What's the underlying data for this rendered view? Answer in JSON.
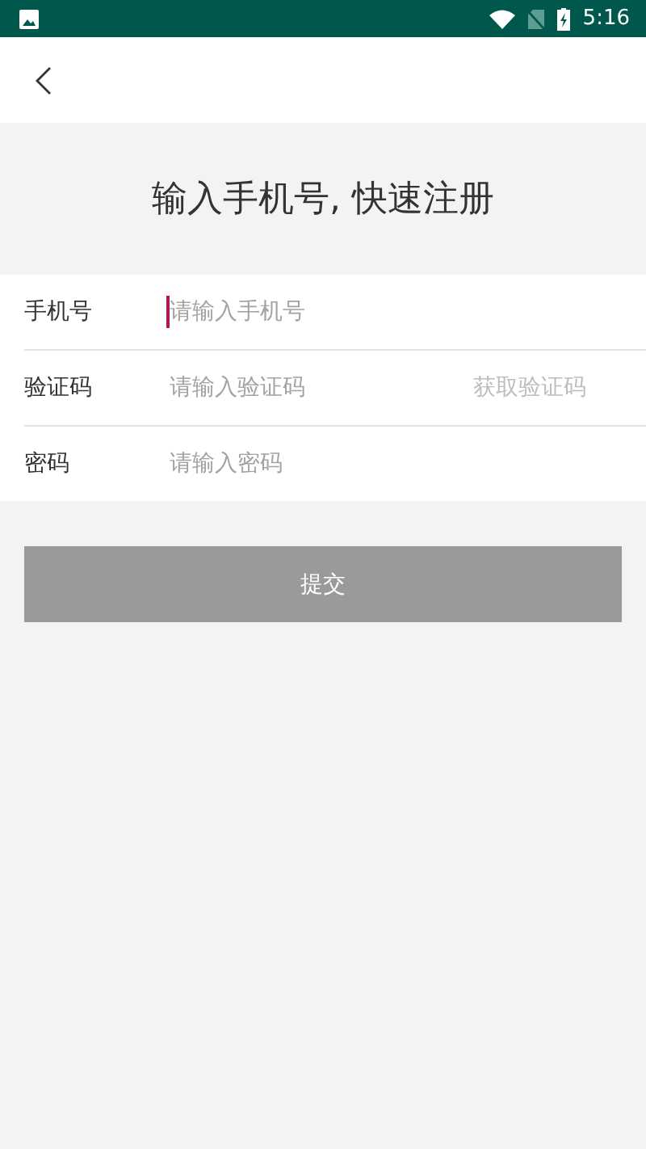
{
  "status_bar": {
    "time": "5:16"
  },
  "title": "输入手机号, 快速注册",
  "fields": [
    {
      "label": "手机号",
      "placeholder": "请输入手机号",
      "focused": true
    },
    {
      "label": "验证码",
      "placeholder": "请输入验证码",
      "focused": false,
      "action": "获取验证码"
    },
    {
      "label": "密码",
      "placeholder": "请输入密码",
      "focused": false
    }
  ],
  "submit": {
    "label": "提交",
    "disabled": true
  }
}
